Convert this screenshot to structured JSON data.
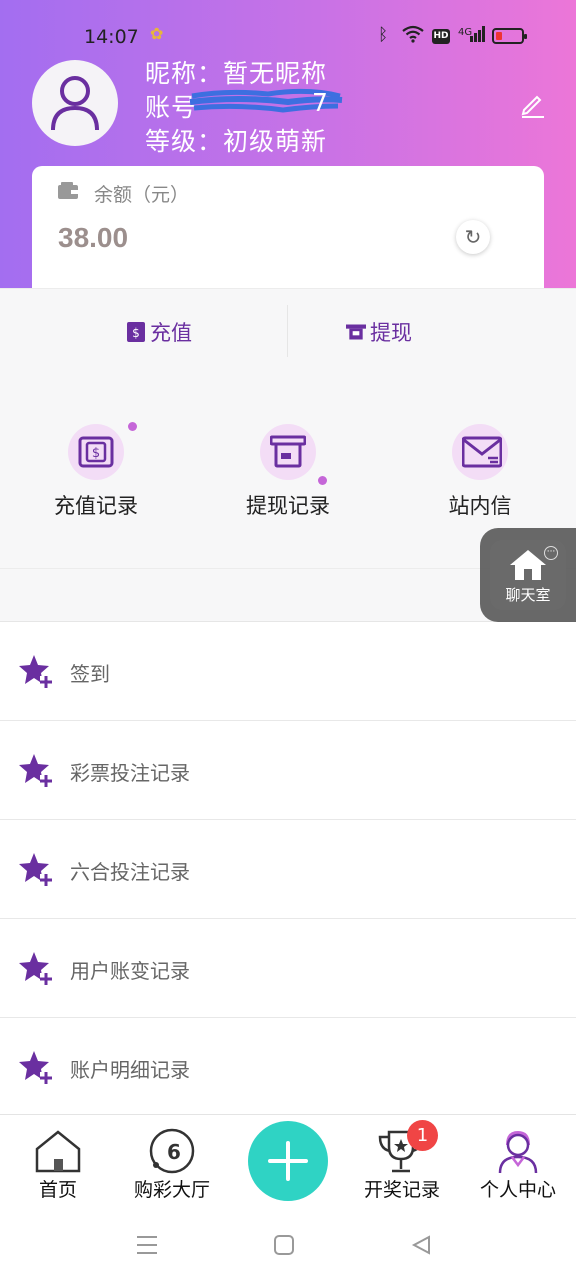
{
  "status_bar": {
    "time": "14:07",
    "icons": [
      "notification-icon",
      "bluetooth-icon",
      "wifi-icon",
      "hd-icon",
      "signal-icon",
      "battery-icon"
    ],
    "network": "4G",
    "hd": "HD",
    "battery_level": 0.25
  },
  "profile": {
    "nickname_line": "昵称：暂无昵称",
    "account_label": "账号",
    "account_value_visible": "7",
    "level_line": "等级：初级萌新"
  },
  "balance": {
    "label": "余额（元）",
    "amount": "38.00"
  },
  "actions": [
    {
      "label": "充值",
      "icon": "recharge-icon"
    },
    {
      "label": "提现",
      "icon": "withdraw-icon"
    }
  ],
  "grid": [
    {
      "label": "充值记录",
      "icon": "recharge-record-icon"
    },
    {
      "label": "提现记录",
      "icon": "withdraw-record-icon"
    },
    {
      "label": "站内信",
      "icon": "mail-icon"
    }
  ],
  "chat": {
    "label": "聊天室",
    "icon": "home-icon"
  },
  "menu": [
    {
      "label": "签到"
    },
    {
      "label": "彩票投注记录"
    },
    {
      "label": "六合投注记录"
    },
    {
      "label": "用户账变记录"
    },
    {
      "label": "账户明细记录"
    }
  ],
  "tabbar": {
    "tabs": [
      {
        "label": "首页",
        "icon": "home-icon"
      },
      {
        "label": "购彩大厅",
        "icon": "lottery-ball-icon",
        "ball_number": "6"
      },
      {
        "label": "开奖记录",
        "icon": "trophy-icon",
        "badge": "1"
      },
      {
        "label": "个人中心",
        "icon": "user-icon"
      }
    ],
    "fab_icon": "plus-icon"
  },
  "colors": {
    "header_gradient_start": "#a36ef0",
    "header_gradient_end": "#ec76d8",
    "accent_purple": "#6a2fa0",
    "fab_teal": "#2fd3c4",
    "badge_red": "#f04545"
  }
}
